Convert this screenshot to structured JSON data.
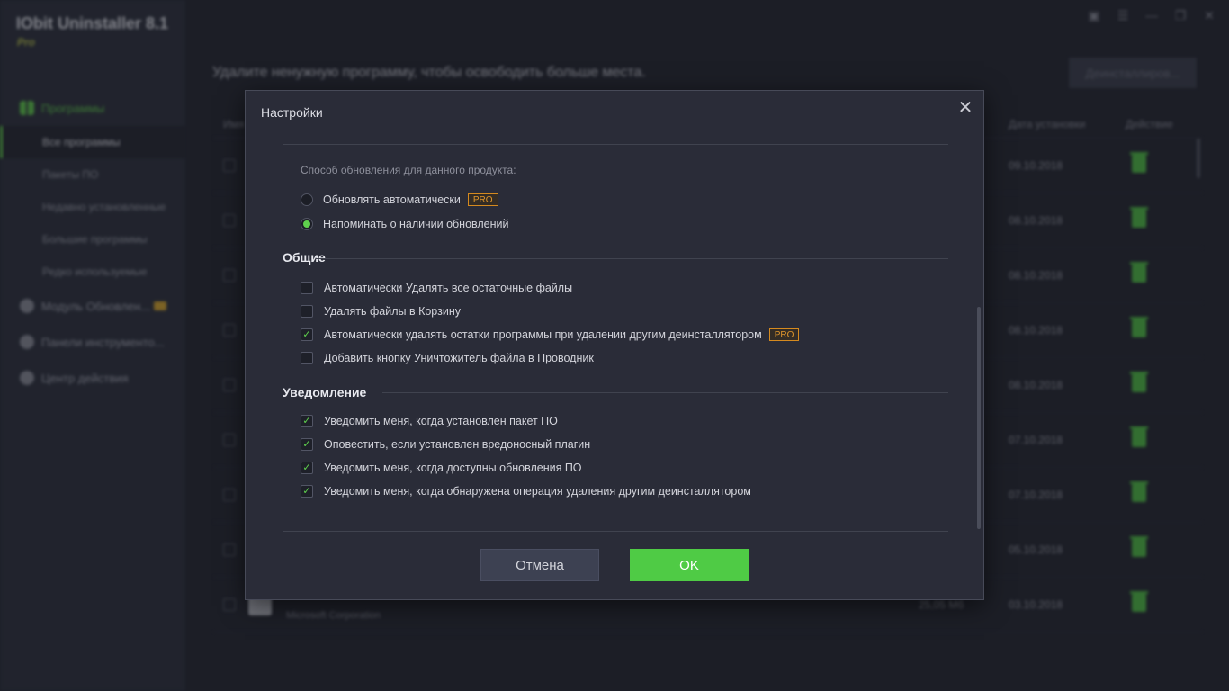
{
  "app": {
    "title": "IObit Uninstaller 8.1",
    "edition": "Pro",
    "heading": "Удалите ненужную программу, чтобы освободить больше места.",
    "uninstall_button": "Деинсталлиров...",
    "sidebar": {
      "groups": [
        {
          "label": "Программы",
          "icon": "grid-icon"
        },
        {
          "label": "Модуль Обновлен...",
          "icon": "update-icon"
        },
        {
          "label": "Панели инструменто...",
          "icon": "puzzle-icon"
        },
        {
          "label": "Центр действия",
          "icon": "flag-icon"
        }
      ],
      "subitems": [
        "Все программы",
        "Пакеты ПО",
        "Недавно установленные",
        "Большие программы",
        "Редко используемые"
      ]
    },
    "table": {
      "headers": {
        "name": "Имя",
        "date": "Дата установки",
        "action": "Действие"
      },
      "rows": [
        {
          "date": "09.10.2018",
          "name": "",
          "publisher": "",
          "size": ""
        },
        {
          "date": "08.10.2018",
          "name": "",
          "publisher": "",
          "size": ""
        },
        {
          "date": "08.10.2018",
          "name": "",
          "publisher": "",
          "size": ""
        },
        {
          "date": "08.10.2018",
          "name": "",
          "publisher": "",
          "size": ""
        },
        {
          "date": "08.10.2018",
          "name": "",
          "publisher": "",
          "size": ""
        },
        {
          "date": "07.10.2018",
          "name": "",
          "publisher": "",
          "size": ""
        },
        {
          "date": "07.10.2018",
          "name": "",
          "publisher": "",
          "size": ""
        },
        {
          "date": "05.10.2018",
          "name": "",
          "publisher": "",
          "size": ""
        },
        {
          "date": "03.10.2018",
          "name": "",
          "publisher": "Microsoft Corporation",
          "size": "25,05 Мб"
        }
      ]
    }
  },
  "dialog": {
    "title": "Настройки",
    "close_icon": "close-icon",
    "update_caption": "Способ обновления для данного продукта:",
    "update_options": [
      {
        "label": "Обновлять автоматически",
        "selected": false,
        "pro": true
      },
      {
        "label": "Напоминать о наличии обновлений",
        "selected": true,
        "pro": false
      }
    ],
    "pro_label": "PRO",
    "general": {
      "title": "Общие",
      "options": [
        {
          "label": "Автоматически Удалять все остаточные файлы",
          "checked": false,
          "pro": false
        },
        {
          "label": "Удалять файлы в Корзину",
          "checked": false,
          "pro": false
        },
        {
          "label": "Автоматически удалять остатки программы при удалении другим деинсталлятором",
          "checked": true,
          "pro": true
        },
        {
          "label": "Добавить кнопку Уничтожитель файла в Проводник",
          "checked": false,
          "pro": false
        }
      ]
    },
    "notify": {
      "title": "Уведомление",
      "options": [
        {
          "label": "Уведомить меня, когда установлен пакет ПО",
          "checked": true
        },
        {
          "label": "Оповестить, если установлен вредоносный плагин",
          "checked": true
        },
        {
          "label": "Уведомить меня, когда доступны обновления ПО",
          "checked": true
        },
        {
          "label": "Уведомить меня, когда обнаружена операция удаления другим деинсталлятором",
          "checked": true
        }
      ]
    },
    "buttons": {
      "cancel": "Отмена",
      "ok": "OK"
    },
    "colors": {
      "accent": "#4fcb45",
      "pro": "#e0962b"
    }
  }
}
